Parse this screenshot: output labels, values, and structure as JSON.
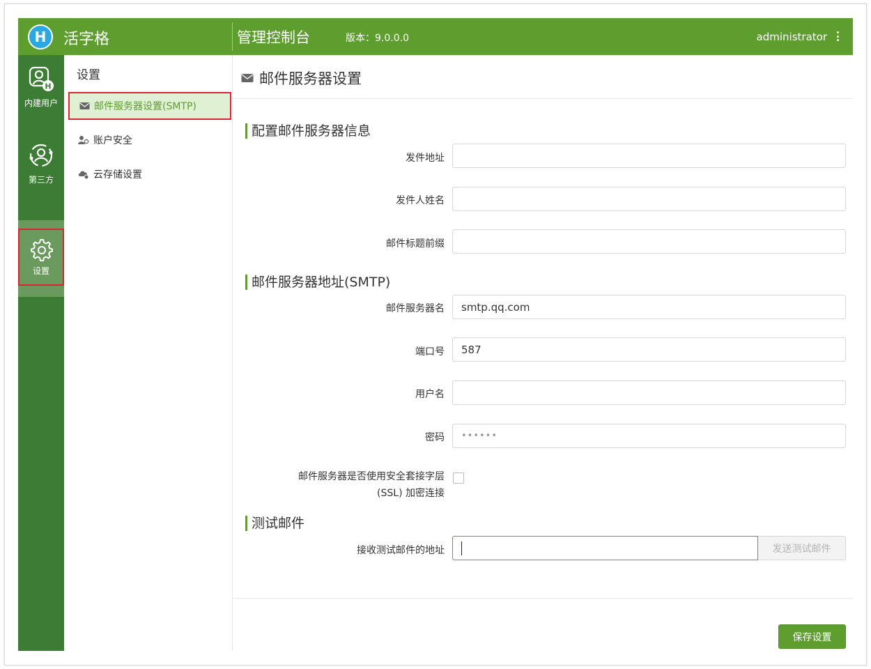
{
  "header": {
    "logo_letter": "H",
    "brand": "活字格",
    "console_title": "管理控制台",
    "version": "版本：9.0.0.0",
    "user": "administrator",
    "menu_icon": "more-vertical-icon"
  },
  "rail": {
    "items": [
      {
        "label": "内建用户",
        "icon": "builtin-user-icon"
      },
      {
        "label": "第三方",
        "icon": "third-party-user-icon"
      },
      {
        "label": "设置",
        "icon": "gear-icon",
        "active": true
      }
    ]
  },
  "subnav": {
    "title": "设置",
    "items": [
      {
        "label": "邮件服务器设置(SMTP)",
        "icon": "envelope-icon",
        "active": true
      },
      {
        "label": "账户安全",
        "icon": "account-security-icon"
      },
      {
        "label": "云存储设置",
        "icon": "cloud-storage-icon"
      }
    ]
  },
  "main": {
    "title": "邮件服务器设置",
    "sections": {
      "config": "配置邮件服务器信息",
      "smtp": "邮件服务器地址(SMTP)",
      "test": "测试邮件"
    },
    "fields": {
      "sender_address": {
        "label": "发件地址",
        "value": ""
      },
      "sender_name": {
        "label": "发件人姓名",
        "value": ""
      },
      "subject_prefix": {
        "label": "邮件标题前缀",
        "value": ""
      },
      "server_name": {
        "label": "邮件服务器名",
        "value": "smtp.qq.com"
      },
      "port": {
        "label": "端口号",
        "value": "587"
      },
      "username": {
        "label": "用户名",
        "value": ""
      },
      "password": {
        "label": "密码",
        "value": "••••••"
      },
      "ssl": {
        "label_line1": "邮件服务器是否使用安全套接字层",
        "label_line2": "(SSL) 加密连接",
        "checked": false
      },
      "test_address": {
        "label": "接收测试邮件的地址",
        "value": ""
      }
    },
    "send_test_button": "发送测试邮件",
    "save_button": "保存设置"
  },
  "colors": {
    "header_green": "#5d9e2f",
    "rail_green": "#3d7c35",
    "active_rail": "#6b9a5e",
    "highlight_red": "#d9252f",
    "logo_blue": "#29a9e0"
  }
}
